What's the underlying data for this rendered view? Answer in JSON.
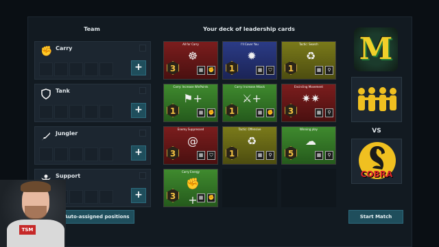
{
  "team": {
    "title": "Team",
    "roles": [
      {
        "label": "Carry",
        "icon": "fist-icon"
      },
      {
        "label": "Tank",
        "icon": "shield-icon"
      },
      {
        "label": "Jungler",
        "icon": "sword-icon"
      },
      {
        "label": "Support",
        "icon": "support-icon"
      }
    ],
    "add_label": "+",
    "auto_assign_label": "Auto-assigned positions"
  },
  "deck": {
    "title": "Your deck of leadership cards",
    "cards": [
      {
        "title": "All for Carry",
        "cost": "3",
        "color": "red",
        "icon": "ship-wheel-icon"
      },
      {
        "title": "I'll Cover You",
        "cost": "1",
        "color": "blue",
        "icon": "explosion-icon"
      },
      {
        "title": "Tactic: Search",
        "cost": "1",
        "color": "olive",
        "icon": "recycle-icon"
      },
      {
        "title": "Carry: Increase WinPoints",
        "cost": "1",
        "color": "green",
        "icon": "flag-plus-icon"
      },
      {
        "title": "Carry: Increase Attack",
        "cost": "1",
        "color": "green",
        "icon": "sword-plus-icon"
      },
      {
        "title": "Encircling Movement",
        "cost": "3",
        "color": "red",
        "icon": "stars-icon"
      },
      {
        "title": "Enemy Suppressed",
        "cost": "3",
        "color": "red",
        "icon": "spiral-icon"
      },
      {
        "title": "Tactic: Offensive",
        "cost": "1",
        "color": "olive",
        "icon": "recycle-icon"
      },
      {
        "title": "Winning play",
        "cost": "5",
        "color": "green",
        "icon": "brain-icon"
      },
      {
        "title": "Carry Energy",
        "cost": "3",
        "color": "green",
        "icon": "fist-plus-icon"
      }
    ]
  },
  "matchup": {
    "team_logo": "M",
    "vs_label": "VS",
    "opponent_name": "COBRA",
    "start_label": "Start Match"
  },
  "webcam": {
    "shirt_text": "TSM"
  }
}
